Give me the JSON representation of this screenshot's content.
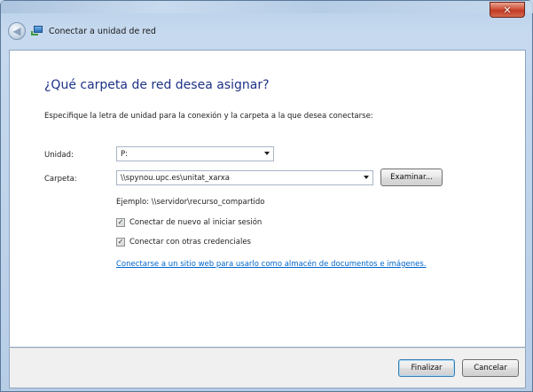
{
  "window": {
    "title": "Conectar a unidad de red",
    "close_glyph": "✕",
    "back_glyph": "◀"
  },
  "content": {
    "heading": "¿Qué carpeta de red desea asignar?",
    "instructions": "Especifique la letra de unidad para la conexión y la carpeta a la que desea conectarse:",
    "drive": {
      "label": "Unidad:",
      "value": "P:"
    },
    "folder": {
      "label": "Carpeta:",
      "value": "\\\\spynou.upc.es\\unitat_xarxa"
    },
    "browse_label": "Examinar...",
    "example": "Ejemplo: \\\\servidor\\recurso_compartido",
    "reconnect": {
      "label": "Conectar de nuevo al iniciar sesión",
      "checked": true
    },
    "other_credentials": {
      "label": "Conectar con otras credenciales",
      "checked": true
    },
    "link": "Conectarse a un sitio web para usarlo como almacén de documentos e imágenes."
  },
  "footer": {
    "finish_label": "Finalizar",
    "cancel_label": "Cancelar"
  },
  "colors": {
    "heading": "#1e3287",
    "link": "#0066cc",
    "close_button": "#c23a24"
  },
  "icons": {
    "back": "back-arrow-icon",
    "network_drive": "network-drive-icon",
    "dropdown": "chevron-down-icon",
    "check": "checkmark-icon"
  }
}
